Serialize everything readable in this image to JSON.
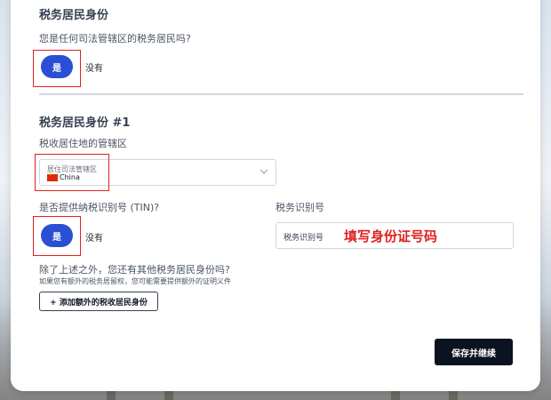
{
  "section1": {
    "title": "税务居民身份",
    "question": "您是任何司法管辖区的税务居民吗?",
    "yes_label": "是",
    "no_label": "没有"
  },
  "section2": {
    "title": "税务居民身份 #1",
    "jurisdiction_label": "税收居住地的管辖区",
    "jurisdiction_placeholder": "居住司法管辖区",
    "jurisdiction_value": "China",
    "tin_question": "是否提供纳税识别号 (TIN)?",
    "tin_yes_label": "是",
    "tin_no_label": "没有",
    "tin_field_label": "税务识别号",
    "tin_field_placeholder": "税务识别号",
    "tin_annotation": "填写身份证号码"
  },
  "other_residency": {
    "question": "除了上述之外，您还有其他税务居民身份吗?",
    "hint": "如果您有额外的税务居留权，您可能需要提供额外的证明义件",
    "add_button_label": "+ 添加额外的税收居民身份"
  },
  "footer": {
    "save_label": "保存并继续"
  },
  "colors": {
    "primary": "#2b4fd4",
    "annotation_red": "#e02020",
    "dark_button": "#0b1320"
  }
}
